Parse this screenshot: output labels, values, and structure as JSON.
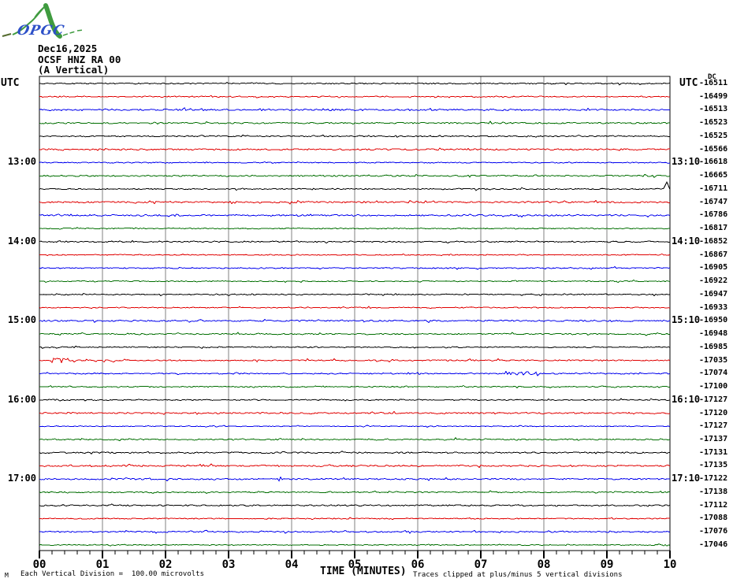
{
  "header": {
    "date": "Dec16,2025",
    "station": "OCSF HNZ RA 00",
    "component": "(A Vertical)"
  },
  "logo": {
    "text": "OPGC"
  },
  "axis_headers": {
    "utc_left": "UTC",
    "utc_right": "UTC",
    "dc": "DC"
  },
  "x_axis": {
    "title": "TIME (MINUTES)",
    "labels": [
      "00",
      "01",
      "02",
      "03",
      "04",
      "05",
      "06",
      "07",
      "08",
      "09",
      "10"
    ]
  },
  "footer": {
    "watermark": "M",
    "scale_note": "Each Vertical Division =  100.00 microvolts",
    "clip_note": "Traces clipped at plus/minus 5 vertical divisions"
  },
  "colors": {
    "black": "#000000",
    "red": "#e00000",
    "blue": "#0000ee",
    "green": "#006e00",
    "grid": "#808080",
    "logo_green": "#3f9b3f",
    "logo_blue": "#2d50c8",
    "logo_dark_dash": "#556b2f"
  },
  "chart_data": {
    "type": "line",
    "subtype": "helicorder seismogram; 36 horizontal traces, 10 minutes per trace, colors cycling black/red/blue/green",
    "title": "OCSF HNZ RA 00 (A Vertical) Dec16,2025",
    "xlabel": "TIME (MINUTES)",
    "x_range_minutes": [
      0,
      10
    ],
    "grid": "vertical gridlines every 1 minute",
    "trace_colors_cycle": [
      "black",
      "red",
      "blue",
      "green"
    ],
    "rows": [
      {
        "color": "black",
        "dc": "-16511"
      },
      {
        "color": "red",
        "dc": "-16499"
      },
      {
        "color": "blue",
        "dc": "-16513"
      },
      {
        "color": "green",
        "dc": "-16523"
      },
      {
        "color": "black",
        "dc": "-16525"
      },
      {
        "color": "red",
        "dc": "-16566"
      },
      {
        "color": "blue",
        "dc": "-16618",
        "left_label": "13:00",
        "right_label": "13:10"
      },
      {
        "color": "green",
        "dc": "-16665"
      },
      {
        "color": "black",
        "dc": "-16711"
      },
      {
        "color": "red",
        "dc": "-16747"
      },
      {
        "color": "blue",
        "dc": "-16786"
      },
      {
        "color": "green",
        "dc": "-16817"
      },
      {
        "color": "black",
        "dc": "-16852",
        "left_label": "14:00",
        "right_label": "14:10"
      },
      {
        "color": "red",
        "dc": "-16867"
      },
      {
        "color": "blue",
        "dc": "-16905"
      },
      {
        "color": "green",
        "dc": "-16922"
      },
      {
        "color": "black",
        "dc": "-16947"
      },
      {
        "color": "red",
        "dc": "-16933"
      },
      {
        "color": "blue",
        "dc": "-16950",
        "left_label": "15:00",
        "right_label": "15:10"
      },
      {
        "color": "green",
        "dc": "-16948"
      },
      {
        "color": "black",
        "dc": "-16985"
      },
      {
        "color": "red",
        "dc": "-17035"
      },
      {
        "color": "blue",
        "dc": "-17074"
      },
      {
        "color": "green",
        "dc": "-17100"
      },
      {
        "color": "black",
        "dc": "-17127",
        "left_label": "16:00",
        "right_label": "16:10"
      },
      {
        "color": "red",
        "dc": "-17120"
      },
      {
        "color": "blue",
        "dc": "-17127"
      },
      {
        "color": "green",
        "dc": "-17137"
      },
      {
        "color": "black",
        "dc": "-17131"
      },
      {
        "color": "red",
        "dc": "-17135"
      },
      {
        "color": "blue",
        "dc": "-17122",
        "left_label": "17:00",
        "right_label": "17:10"
      },
      {
        "color": "green",
        "dc": "-17138"
      },
      {
        "color": "black",
        "dc": "-17112"
      },
      {
        "color": "red",
        "dc": "-17088"
      },
      {
        "color": "blue",
        "dc": "-17076"
      },
      {
        "color": "green",
        "dc": "-17046"
      }
    ],
    "events": [
      {
        "row": 9,
        "shape": "spike",
        "m0": 9.9,
        "m1": 10.0,
        "amp": 9,
        "description": "upward spike at end of black trace"
      },
      {
        "row": 22,
        "shape": "burst",
        "m0": 0.2,
        "m1": 0.55,
        "amp": 3,
        "description": "short noise burst on red trace"
      },
      {
        "row": 23,
        "shape": "burst",
        "m0": 7.4,
        "m1": 7.9,
        "amp": 2.5,
        "description": "short noise burst on blue trace"
      }
    ]
  }
}
